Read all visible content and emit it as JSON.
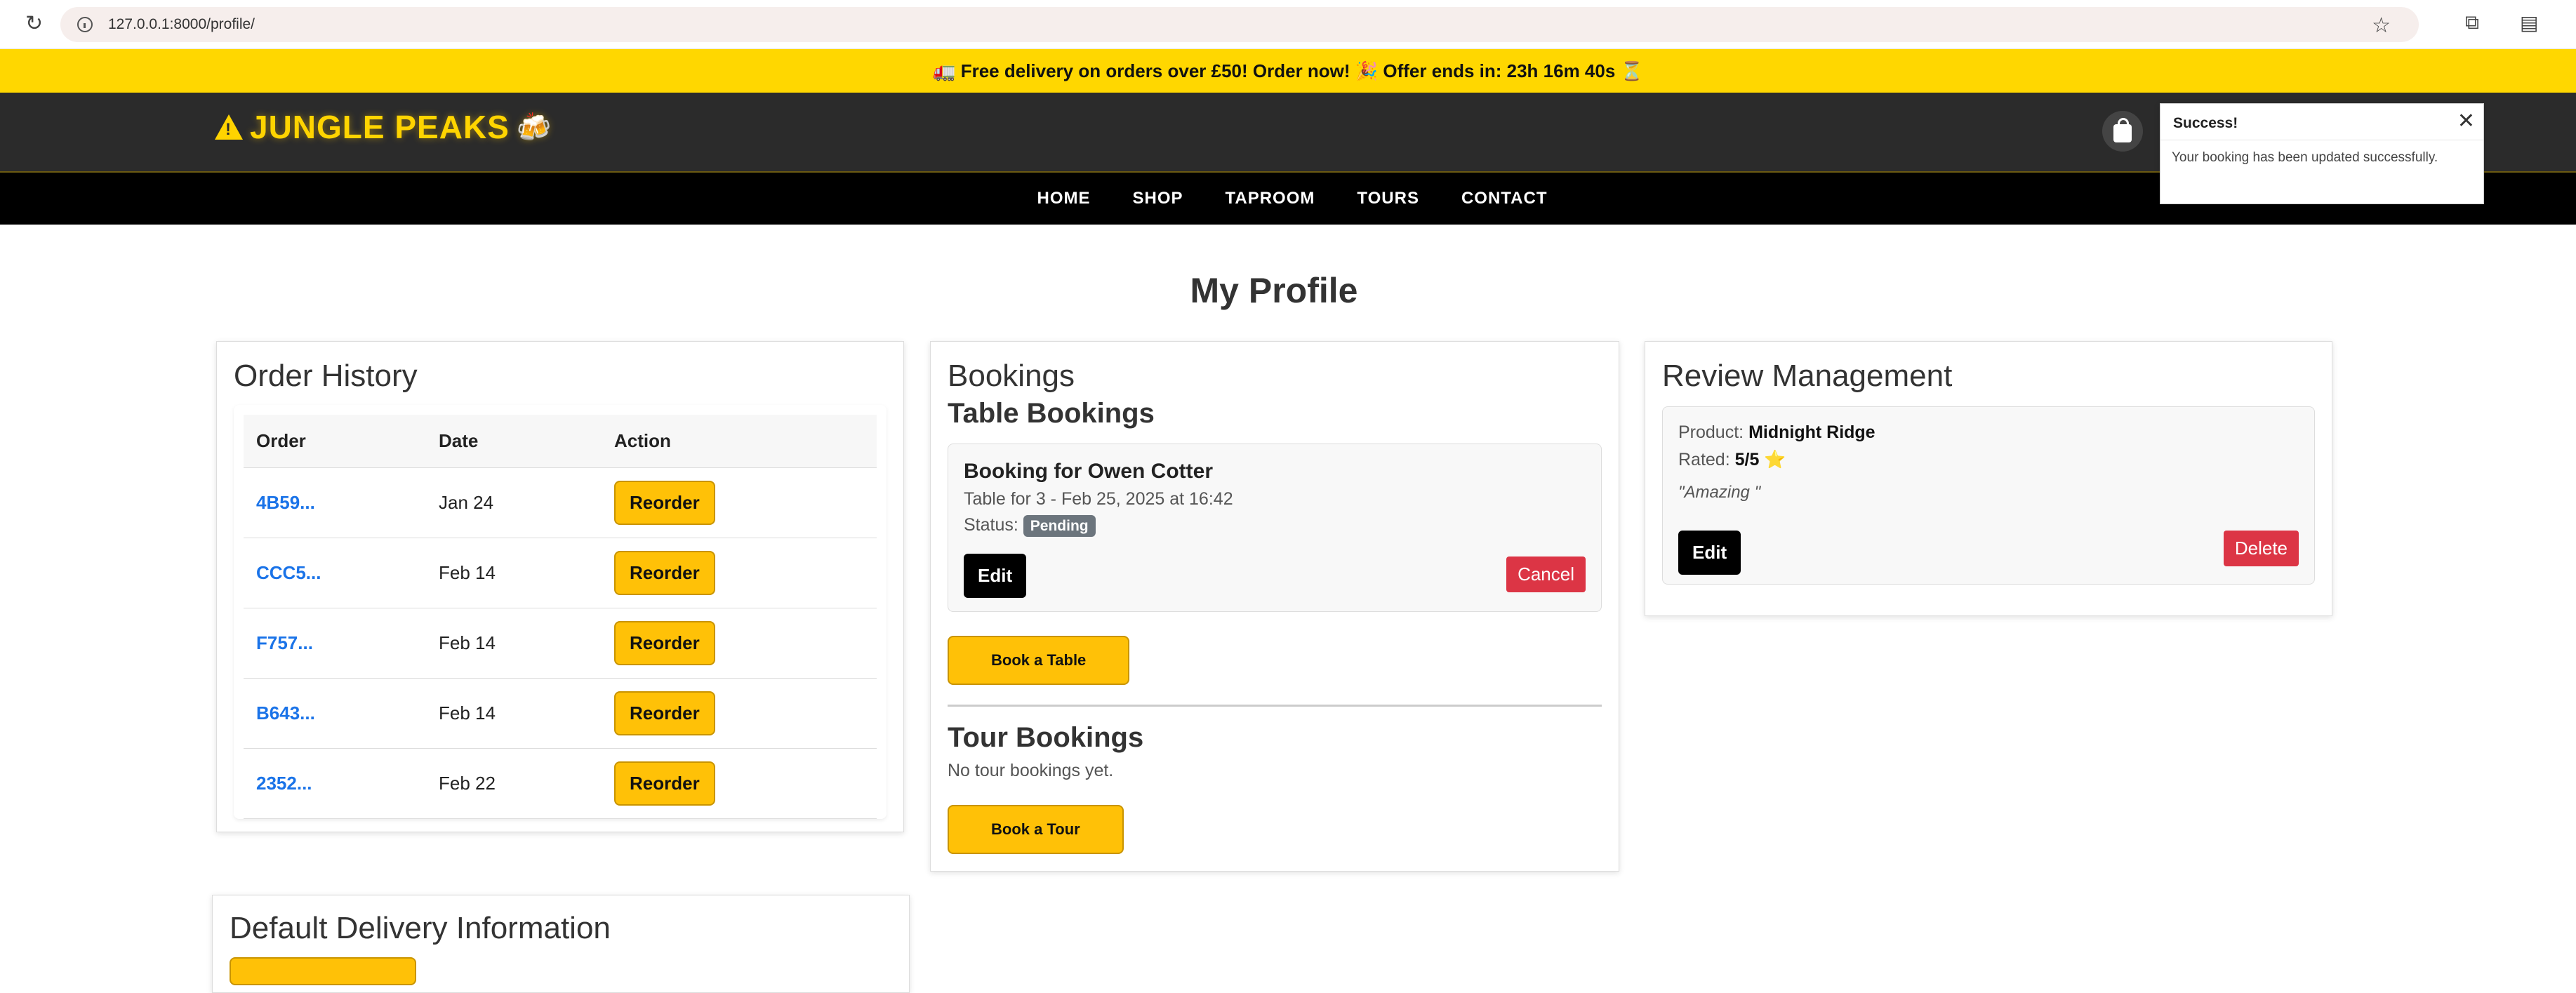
{
  "browser": {
    "url": "127.0.0.1:8000/profile/"
  },
  "promo": {
    "text": "🚛 Free delivery on orders over £50! Order now! 🎉 Offer ends in: 23h 16m 40s ⏳"
  },
  "header": {
    "brand": "JUNGLE PEAKS",
    "mug": "🍻"
  },
  "nav": {
    "items": [
      "HOME",
      "SHOP",
      "TAPROOM",
      "TOURS",
      "CONTACT"
    ]
  },
  "toast": {
    "title": "Success!",
    "message": "Your booking has been updated successfully.",
    "close": "✕"
  },
  "page": {
    "title": "My Profile"
  },
  "orders": {
    "title": "Order History",
    "columns": [
      "Order",
      "Date",
      "Action"
    ],
    "rows": [
      {
        "id": "4B59...",
        "date": "Jan 24",
        "action": "Reorder"
      },
      {
        "id": "CCC5...",
        "date": "Feb 14",
        "action": "Reorder"
      },
      {
        "id": "F757...",
        "date": "Feb 14",
        "action": "Reorder"
      },
      {
        "id": "B643...",
        "date": "Feb 14",
        "action": "Reorder"
      },
      {
        "id": "2352...",
        "date": "Feb 22",
        "action": "Reorder"
      }
    ]
  },
  "bookings": {
    "title": "Bookings",
    "table_heading": "Table Bookings",
    "item": {
      "title": "Booking for Owen Cotter",
      "detail": "Table for 3 - Feb 25, 2025 at 16:42",
      "status_label": "Status:",
      "status": "Pending",
      "edit": "Edit",
      "cancel": "Cancel"
    },
    "book_table": "Book a Table",
    "tour_heading": "Tour Bookings",
    "no_tours": "No tour bookings yet.",
    "book_tour": "Book a Tour"
  },
  "reviews": {
    "title": "Review Management",
    "product_label": "Product:",
    "product": "Midnight Ridge",
    "rated_label": "Rated:",
    "rating": "5/5",
    "star": "⭐",
    "quote": "\"Amazing \"",
    "edit": "Edit",
    "delete": "Delete"
  },
  "delivery": {
    "title": "Default Delivery Information"
  }
}
